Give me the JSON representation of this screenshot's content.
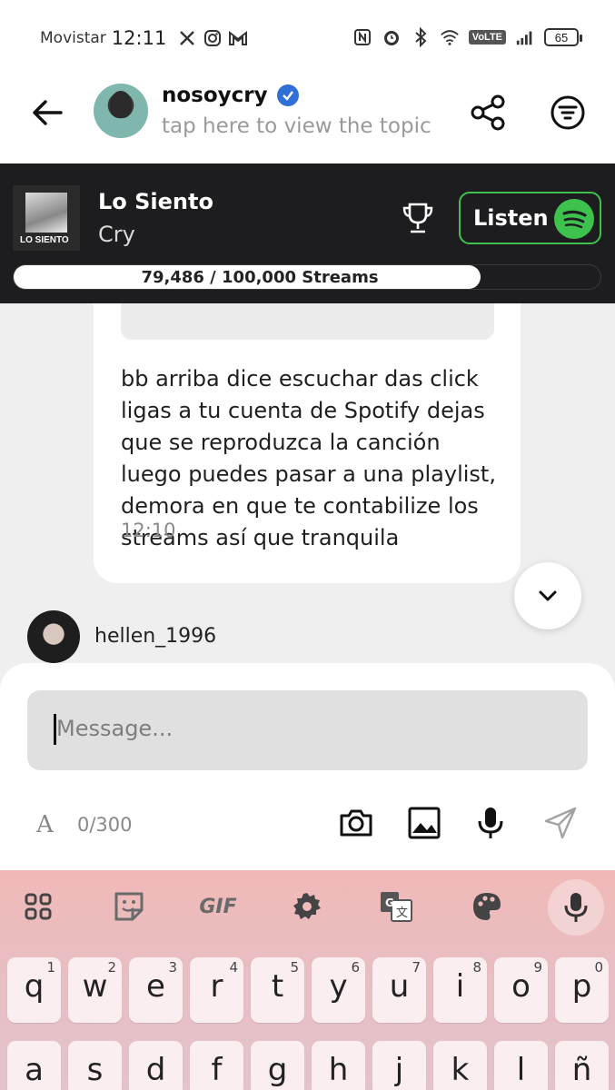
{
  "status_bar": {
    "carrier": "Movistar",
    "time": "12:11",
    "volte": "VoLTE",
    "battery": "65",
    "icons": [
      "x-icon",
      "instagram-icon",
      "gmail-icon",
      "nfc-icon",
      "alarm-icon",
      "bluetooth-icon",
      "wifi-icon",
      "signal-icon",
      "battery-icon"
    ]
  },
  "header": {
    "username": "nosoycry",
    "subtitle": "tap here to view the topic",
    "verified": true
  },
  "song": {
    "title": "Lo Siento",
    "artist": "Cry",
    "cover_text": "LO SIENTO",
    "listen_label": "Listen",
    "streams_label": "79,486 / 100,000 Streams",
    "streams_progress": 0.79486,
    "accent": "#3ec24e"
  },
  "chat": {
    "message": "bb arriba dice escuchar das click ligas a tu cuenta de Spotify dejas que se reproduzca la canción luego puedes pasar a una playlist, demora en que te contabilize los streams así que tranquila",
    "message_time": "12:10",
    "next_user": "hellen_1996"
  },
  "composer": {
    "placeholder": "Message...",
    "font_glyph": "A",
    "counter": "0/300"
  },
  "keyboard": {
    "tools": [
      "apps-grid-icon",
      "sticker-icon",
      "gif-icon",
      "settings-icon",
      "translate-icon",
      "palette-icon",
      "mic-icon"
    ],
    "gif_label": "GIF",
    "row1": [
      {
        "k": "q",
        "n": "1"
      },
      {
        "k": "w",
        "n": "2"
      },
      {
        "k": "e",
        "n": "3"
      },
      {
        "k": "r",
        "n": "4"
      },
      {
        "k": "t",
        "n": "5"
      },
      {
        "k": "y",
        "n": "6"
      },
      {
        "k": "u",
        "n": "7"
      },
      {
        "k": "i",
        "n": "8"
      },
      {
        "k": "o",
        "n": "9"
      },
      {
        "k": "p",
        "n": "0"
      }
    ],
    "row2": [
      "a",
      "s",
      "d",
      "f",
      "g",
      "h",
      "j",
      "k",
      "l",
      "ñ"
    ]
  }
}
